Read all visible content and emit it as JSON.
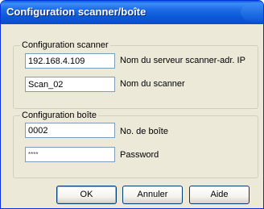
{
  "window": {
    "title": "Configuration scanner/boîte"
  },
  "scanner_group": {
    "legend": "Configuration scanner",
    "ip_value": "192.168.4.109",
    "ip_label": "Nom du serveur scanner-adr. IP",
    "name_value": "Scan_02",
    "name_label": "Nom du scanner"
  },
  "box_group": {
    "legend": "Configuration boîte",
    "box_value": "0002",
    "box_label": "No. de boîte",
    "password_value": "****",
    "password_label": "Password"
  },
  "buttons": {
    "ok": "OK",
    "cancel": "Annuler",
    "help": "Aide"
  }
}
